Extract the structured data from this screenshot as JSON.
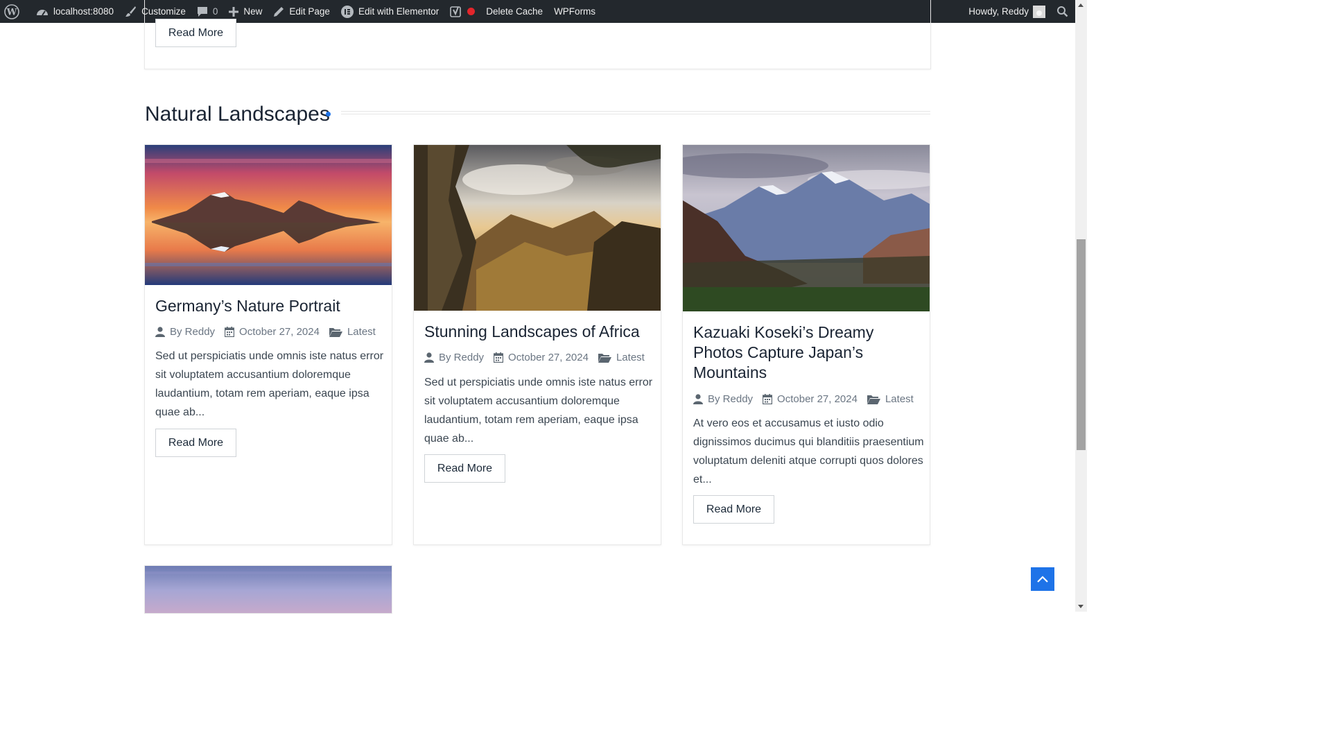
{
  "adminbar": {
    "site": "localhost:8080",
    "customize": "Customize",
    "comments": "0",
    "new": "New",
    "edit_page": "Edit Page",
    "elementor": "Edit with Elementor",
    "delete_cache": "Delete Cache",
    "wpforms": "WPForms",
    "howdy": "Howdy, Reddy"
  },
  "prev_card": {
    "read_more": "Read More"
  },
  "section": {
    "title": "Natural Landscapes",
    "accent": "#1e73e8"
  },
  "posts": [
    {
      "title": "Germany’s Nature Portrait",
      "author": "By Reddy",
      "date": "October 27, 2024",
      "category": "Latest",
      "excerpt": "Sed ut perspiciatis unde omnis iste natus error sit voluptatem accusantium doloremque laudantium, totam rem aperiam, eaque ipsa quae ab...",
      "read_more": "Read More"
    },
    {
      "title": "Stunning Landscapes of Africa",
      "author": "By Reddy",
      "date": "October 27, 2024",
      "category": "Latest",
      "excerpt": "Sed ut perspiciatis unde omnis iste natus error sit voluptatem accusantium doloremque laudantium, totam rem aperiam, eaque ipsa quae ab...",
      "read_more": "Read More"
    },
    {
      "title": "Kazuaki Koseki’s Dreamy Photos Capture Japan’s Mountains",
      "author": "By Reddy",
      "date": "October 27, 2024",
      "category": "Latest",
      "excerpt": "At vero eos et accusamus et iusto odio dignissimos ducimus qui blanditiis praesentium voluptatum deleniti atque corrupti quos dolores et...",
      "read_more": "Read More"
    }
  ],
  "icons": {
    "wordpress": "wordpress-logo-icon",
    "dashboard": "dashboard-icon",
    "customize": "brush-icon",
    "comments": "comment-bubble-icon",
    "new": "plus-icon",
    "edit": "pencil-icon",
    "elementor": "elementor-icon",
    "yoast": "yoast-icon",
    "search": "search-icon",
    "author": "user-icon",
    "date": "calendar-icon",
    "category": "folder-icon",
    "to_top": "chevron-up-icon"
  }
}
